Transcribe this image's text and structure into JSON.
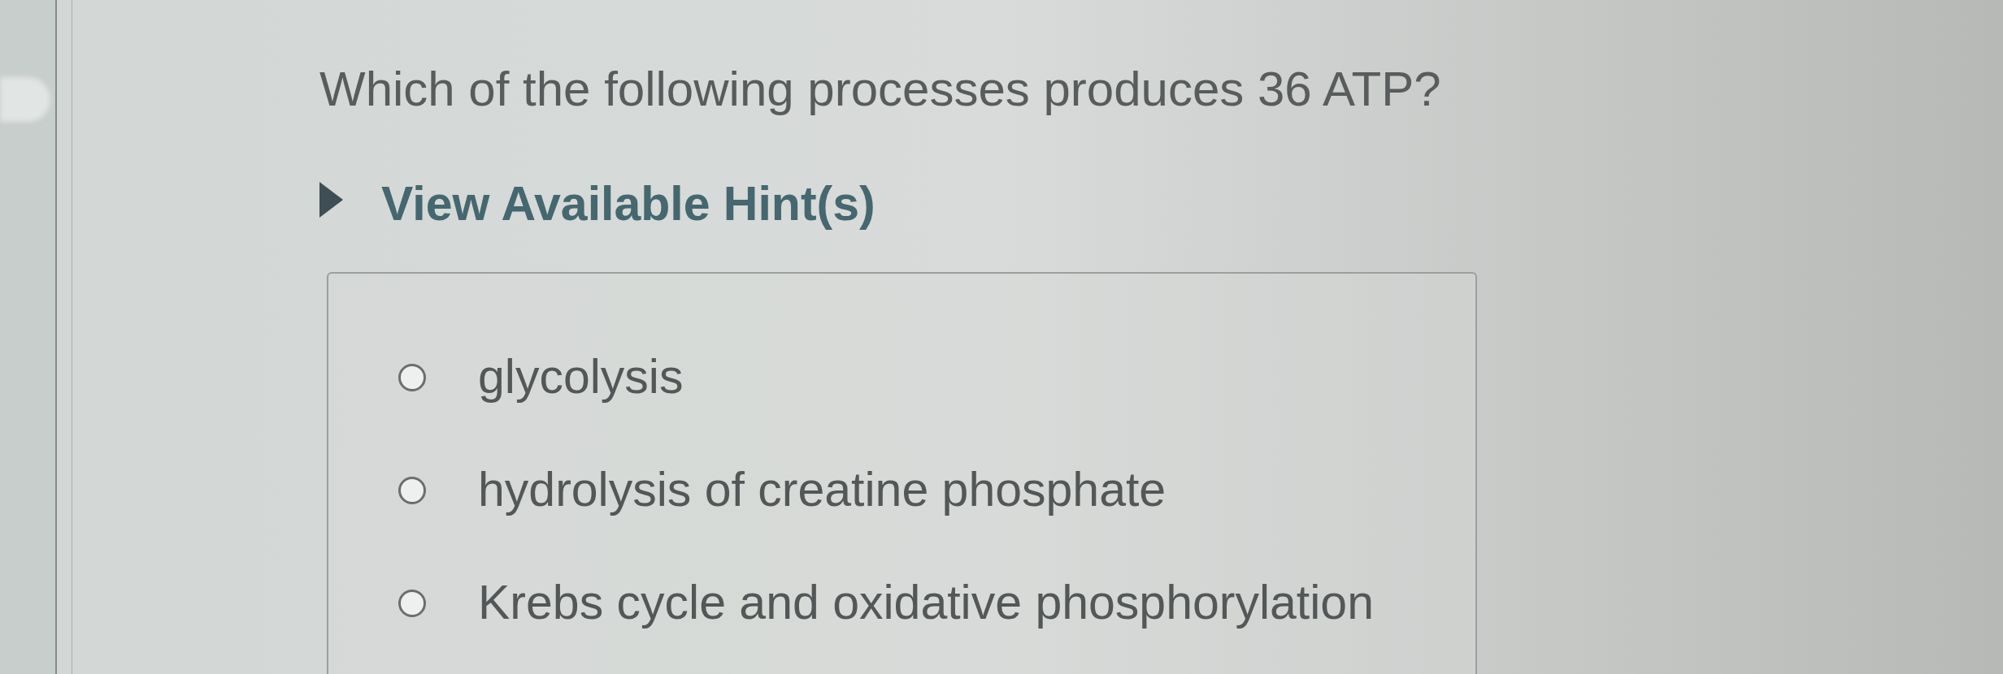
{
  "question": "Which of the following processes produces 36 ATP?",
  "hint_toggle": {
    "label": "View Available Hint(s)",
    "expanded": false
  },
  "choices": [
    {
      "label": "glycolysis",
      "selected": false
    },
    {
      "label": "hydrolysis of creatine phosphate",
      "selected": false
    },
    {
      "label": "Krebs cycle and oxidative phosphorylation",
      "selected": false
    }
  ]
}
